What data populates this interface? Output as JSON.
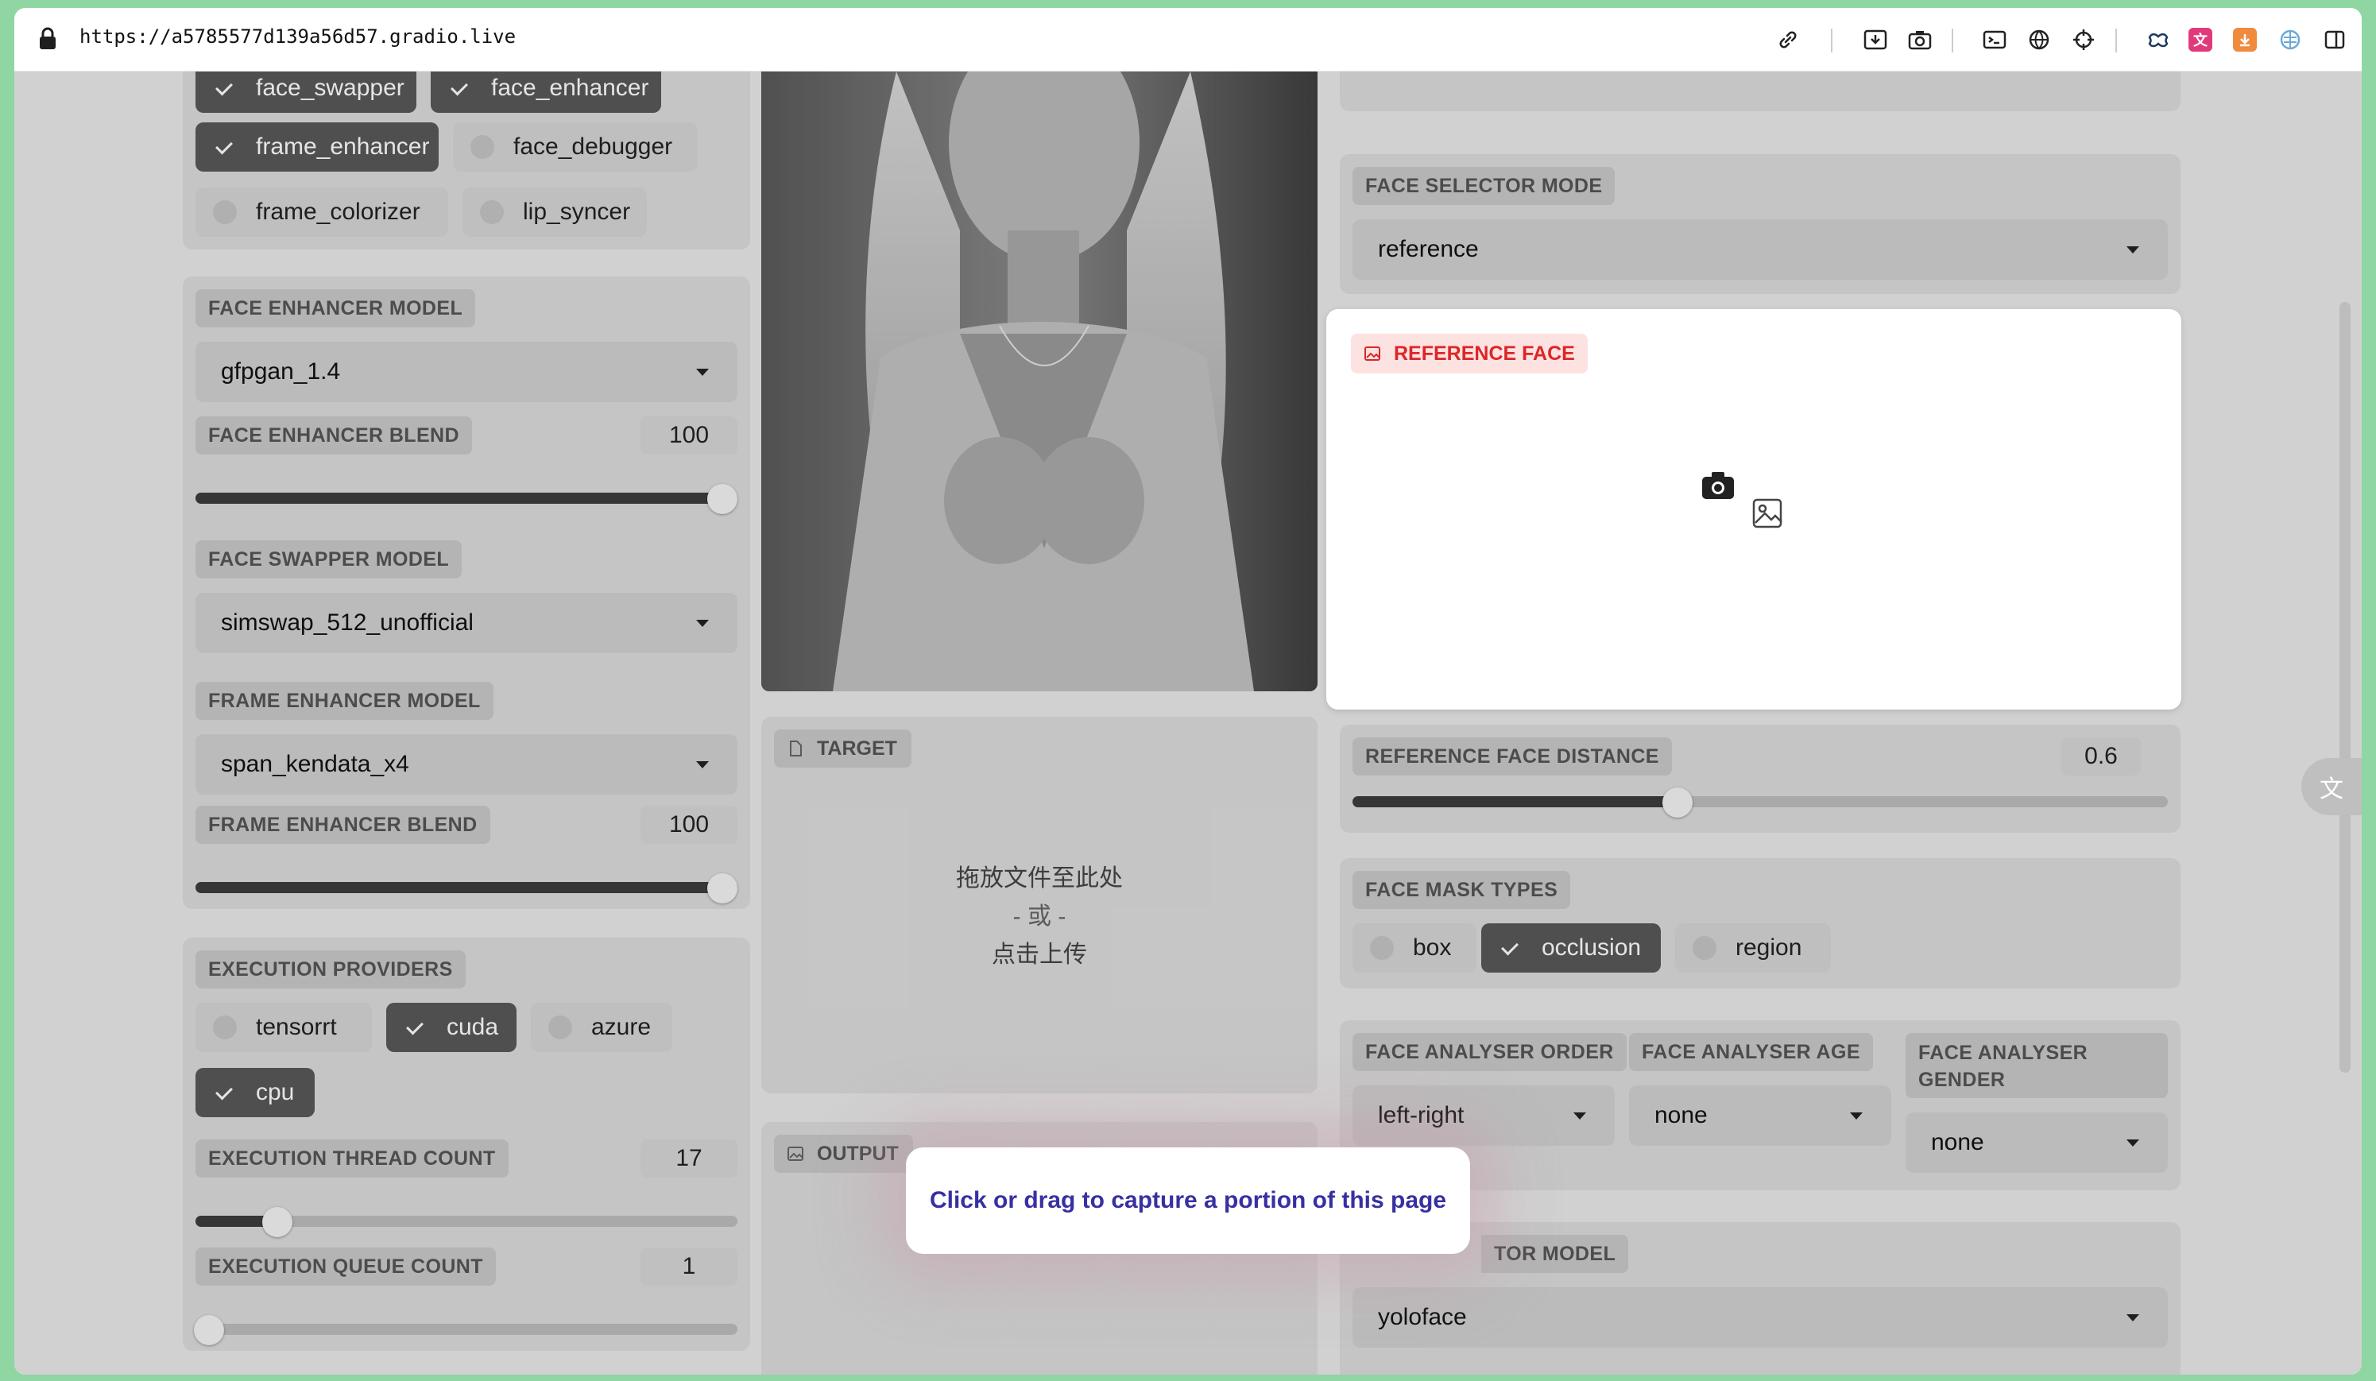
{
  "browser": {
    "url": "https://a5785577d139a56d57.gradio.live",
    "toolbar_icons": [
      "link-icon",
      "save-page-icon",
      "camera-icon",
      "terminal-icon",
      "globe-icon",
      "crosshair-icon",
      "extension-icon",
      "translate-icon",
      "download-icon",
      "ai-icon",
      "sidebar-icon"
    ]
  },
  "processors": {
    "items": [
      {
        "label": "face_swapper",
        "checked": true
      },
      {
        "label": "face_enhancer",
        "checked": true
      },
      {
        "label": "frame_enhancer",
        "checked": true
      },
      {
        "label": "face_debugger",
        "checked": false
      },
      {
        "label": "frame_colorizer",
        "checked": false
      },
      {
        "label": "lip_syncer",
        "checked": false
      }
    ]
  },
  "face_enhancer_model": {
    "label": "FACE ENHANCER MODEL",
    "value": "gfpgan_1.4"
  },
  "face_enhancer_blend": {
    "label": "FACE ENHANCER BLEND",
    "value": "100",
    "level": 1.0
  },
  "face_swapper_model": {
    "label": "FACE SWAPPER MODEL",
    "value": "simswap_512_unofficial"
  },
  "frame_enhancer_model": {
    "label": "FRAME ENHANCER MODEL",
    "value": "span_kendata_x4"
  },
  "frame_enhancer_blend": {
    "label": "FRAME ENHANCER BLEND",
    "value": "100",
    "level": 1.0
  },
  "execution_providers": {
    "label": "EXECUTION PROVIDERS",
    "items": [
      {
        "label": "tensorrt",
        "checked": false
      },
      {
        "label": "cuda",
        "checked": true
      },
      {
        "label": "azure",
        "checked": false
      },
      {
        "label": "cpu",
        "checked": true
      }
    ]
  },
  "execution_thread_count": {
    "label": "EXECUTION THREAD COUNT",
    "value": "17",
    "level": 0.15
  },
  "execution_queue_count": {
    "label": "EXECUTION QUEUE COUNT",
    "value": "1",
    "level": 0.0
  },
  "target": {
    "label": "TARGET",
    "drop_line1": "拖放文件至此处",
    "drop_or": "- 或 -",
    "drop_line2": "点击上传"
  },
  "output": {
    "label": "OUTPUT"
  },
  "face_selector_mode": {
    "label": "FACE SELECTOR MODE",
    "value": "reference"
  },
  "reference_face": {
    "label": "REFERENCE FACE"
  },
  "reference_face_distance": {
    "label": "REFERENCE FACE DISTANCE",
    "value": "0.6",
    "level": 0.4
  },
  "face_mask_types": {
    "label": "FACE MASK TYPES",
    "items": [
      {
        "label": "box",
        "checked": false
      },
      {
        "label": "occlusion",
        "checked": true
      },
      {
        "label": "region",
        "checked": false
      }
    ]
  },
  "face_analyser_order": {
    "label": "FACE ANALYSER ORDER",
    "value": "left-right"
  },
  "face_analyser_age": {
    "label": "FACE ANALYSER AGE",
    "value": "none"
  },
  "face_analyser_gender": {
    "label": "FACE ANALYSER GENDER",
    "value": "none"
  },
  "face_detector_model": {
    "label_visible": "TOR MODEL",
    "value": "yoloface"
  },
  "capture_tooltip": "Click or drag to capture a portion of this page",
  "colors": {
    "accent_red": "#dc2626",
    "tooltip_text": "#3730a3",
    "chip_on": "#595959"
  }
}
